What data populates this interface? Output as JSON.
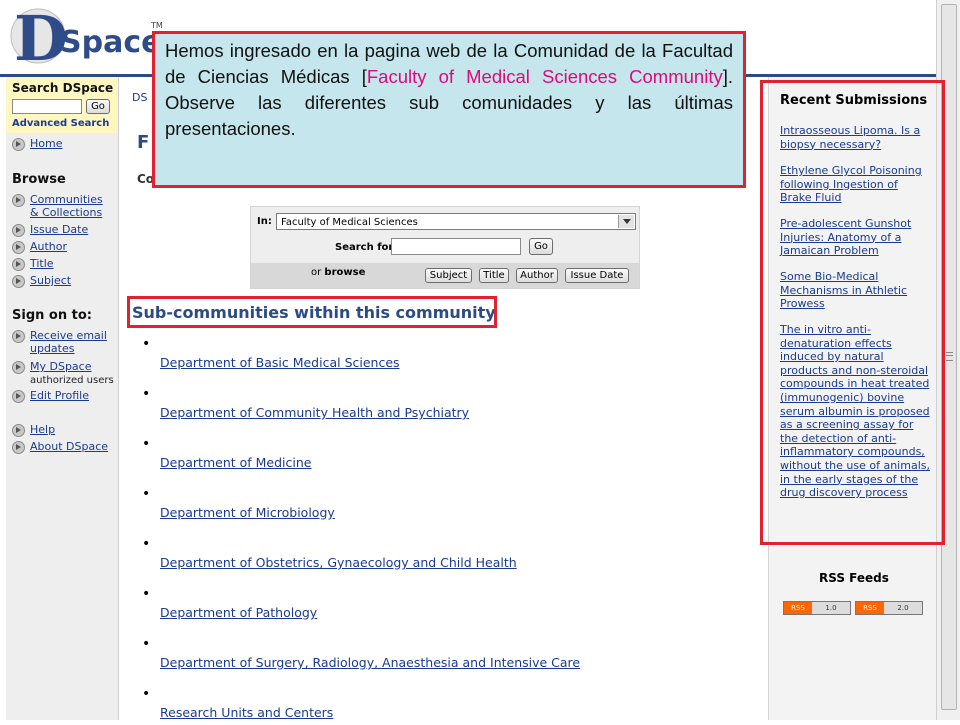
{
  "header": {
    "logo_text_d": "D",
    "logo_text_space": "Space",
    "logo_tm": "TM"
  },
  "sidebar": {
    "search_heading": "Search DSpace",
    "search_go": "Go",
    "advanced_search": "Advanced Search",
    "home": "Home",
    "browse_heading": "Browse",
    "browse_items": [
      "Communities & Collections",
      "Issue Date",
      "Author",
      "Title",
      "Subject"
    ],
    "signon_heading": "Sign on to:",
    "receive_email": "Receive email updates",
    "my_dspace": "My DSpace",
    "my_dspace_note": "authorized users",
    "edit_profile": "Edit Profile",
    "help": "Help",
    "about": "About DSpace"
  },
  "main": {
    "breadcrumb": "DS",
    "title_partial": "F",
    "community_label_partial": "Co",
    "search_widget": {
      "in_label": "In:",
      "scope_value": "Faculty of Medical Sciences",
      "search_for_label": "Search for",
      "go_label": "Go",
      "or_label": "or",
      "browse_label": "browse",
      "browse_buttons": [
        "Subject",
        "Title",
        "Author",
        "Issue Date"
      ]
    },
    "subcommunities_heading": "Sub-communities within this community",
    "subcommunity_bullet": "•",
    "subcommunities": [
      "Department of Basic Medical Sciences",
      "Department of Community Health and Psychiatry",
      "Department of Medicine",
      "Department of Microbiology",
      "Department of Obstetrics, Gynaecology and Child Health",
      "Department of Pathology",
      "Department of Surgery, Radiology, Anaesthesia and Intensive Care",
      "Research Units and Centers"
    ]
  },
  "recent": {
    "heading": "Recent Submissions",
    "items": [
      "Intraosseous Lipoma. Is a biopsy necessary?",
      "Ethylene Glycol Poisoning following Ingestion of Brake Fluid",
      "Pre-adolescent Gunshot Injuries: Anatomy of a Jamaican Problem",
      "Some Bio-Medical Mechanisms in Athletic Prowess",
      "The in vitro anti-denaturation effects induced by natural products and non-steroidal compounds in heat treated (immunogenic) bovine serum albumin is proposed as a screening assay for the detection of anti-inflammatory compounds, without the use of animals, in the early stages of the drug discovery process"
    ],
    "rss_heading": "RSS Feeds",
    "rss_badges": [
      {
        "left": "RSS",
        "right": "1.0"
      },
      {
        "left": "RSS",
        "right": "2.0"
      }
    ]
  },
  "annotation": {
    "text_before": "Hemos ingresado en  la pagina web de la Comunidad de la Facultad de Ciencias Médicas [",
    "text_highlight": "Faculty of Medical Sciences Community",
    "text_after": "]. Observe las diferentes sub comunidades y las últimas presentaciones."
  },
  "colors": {
    "brand_blue": "#2c4a84",
    "link": "#1a3a8f",
    "annotation_border": "#e0212f",
    "annotation_fill": "#c5e6ed",
    "annotation_highlight": "#e0087a",
    "rss_orange": "#ff6600"
  }
}
